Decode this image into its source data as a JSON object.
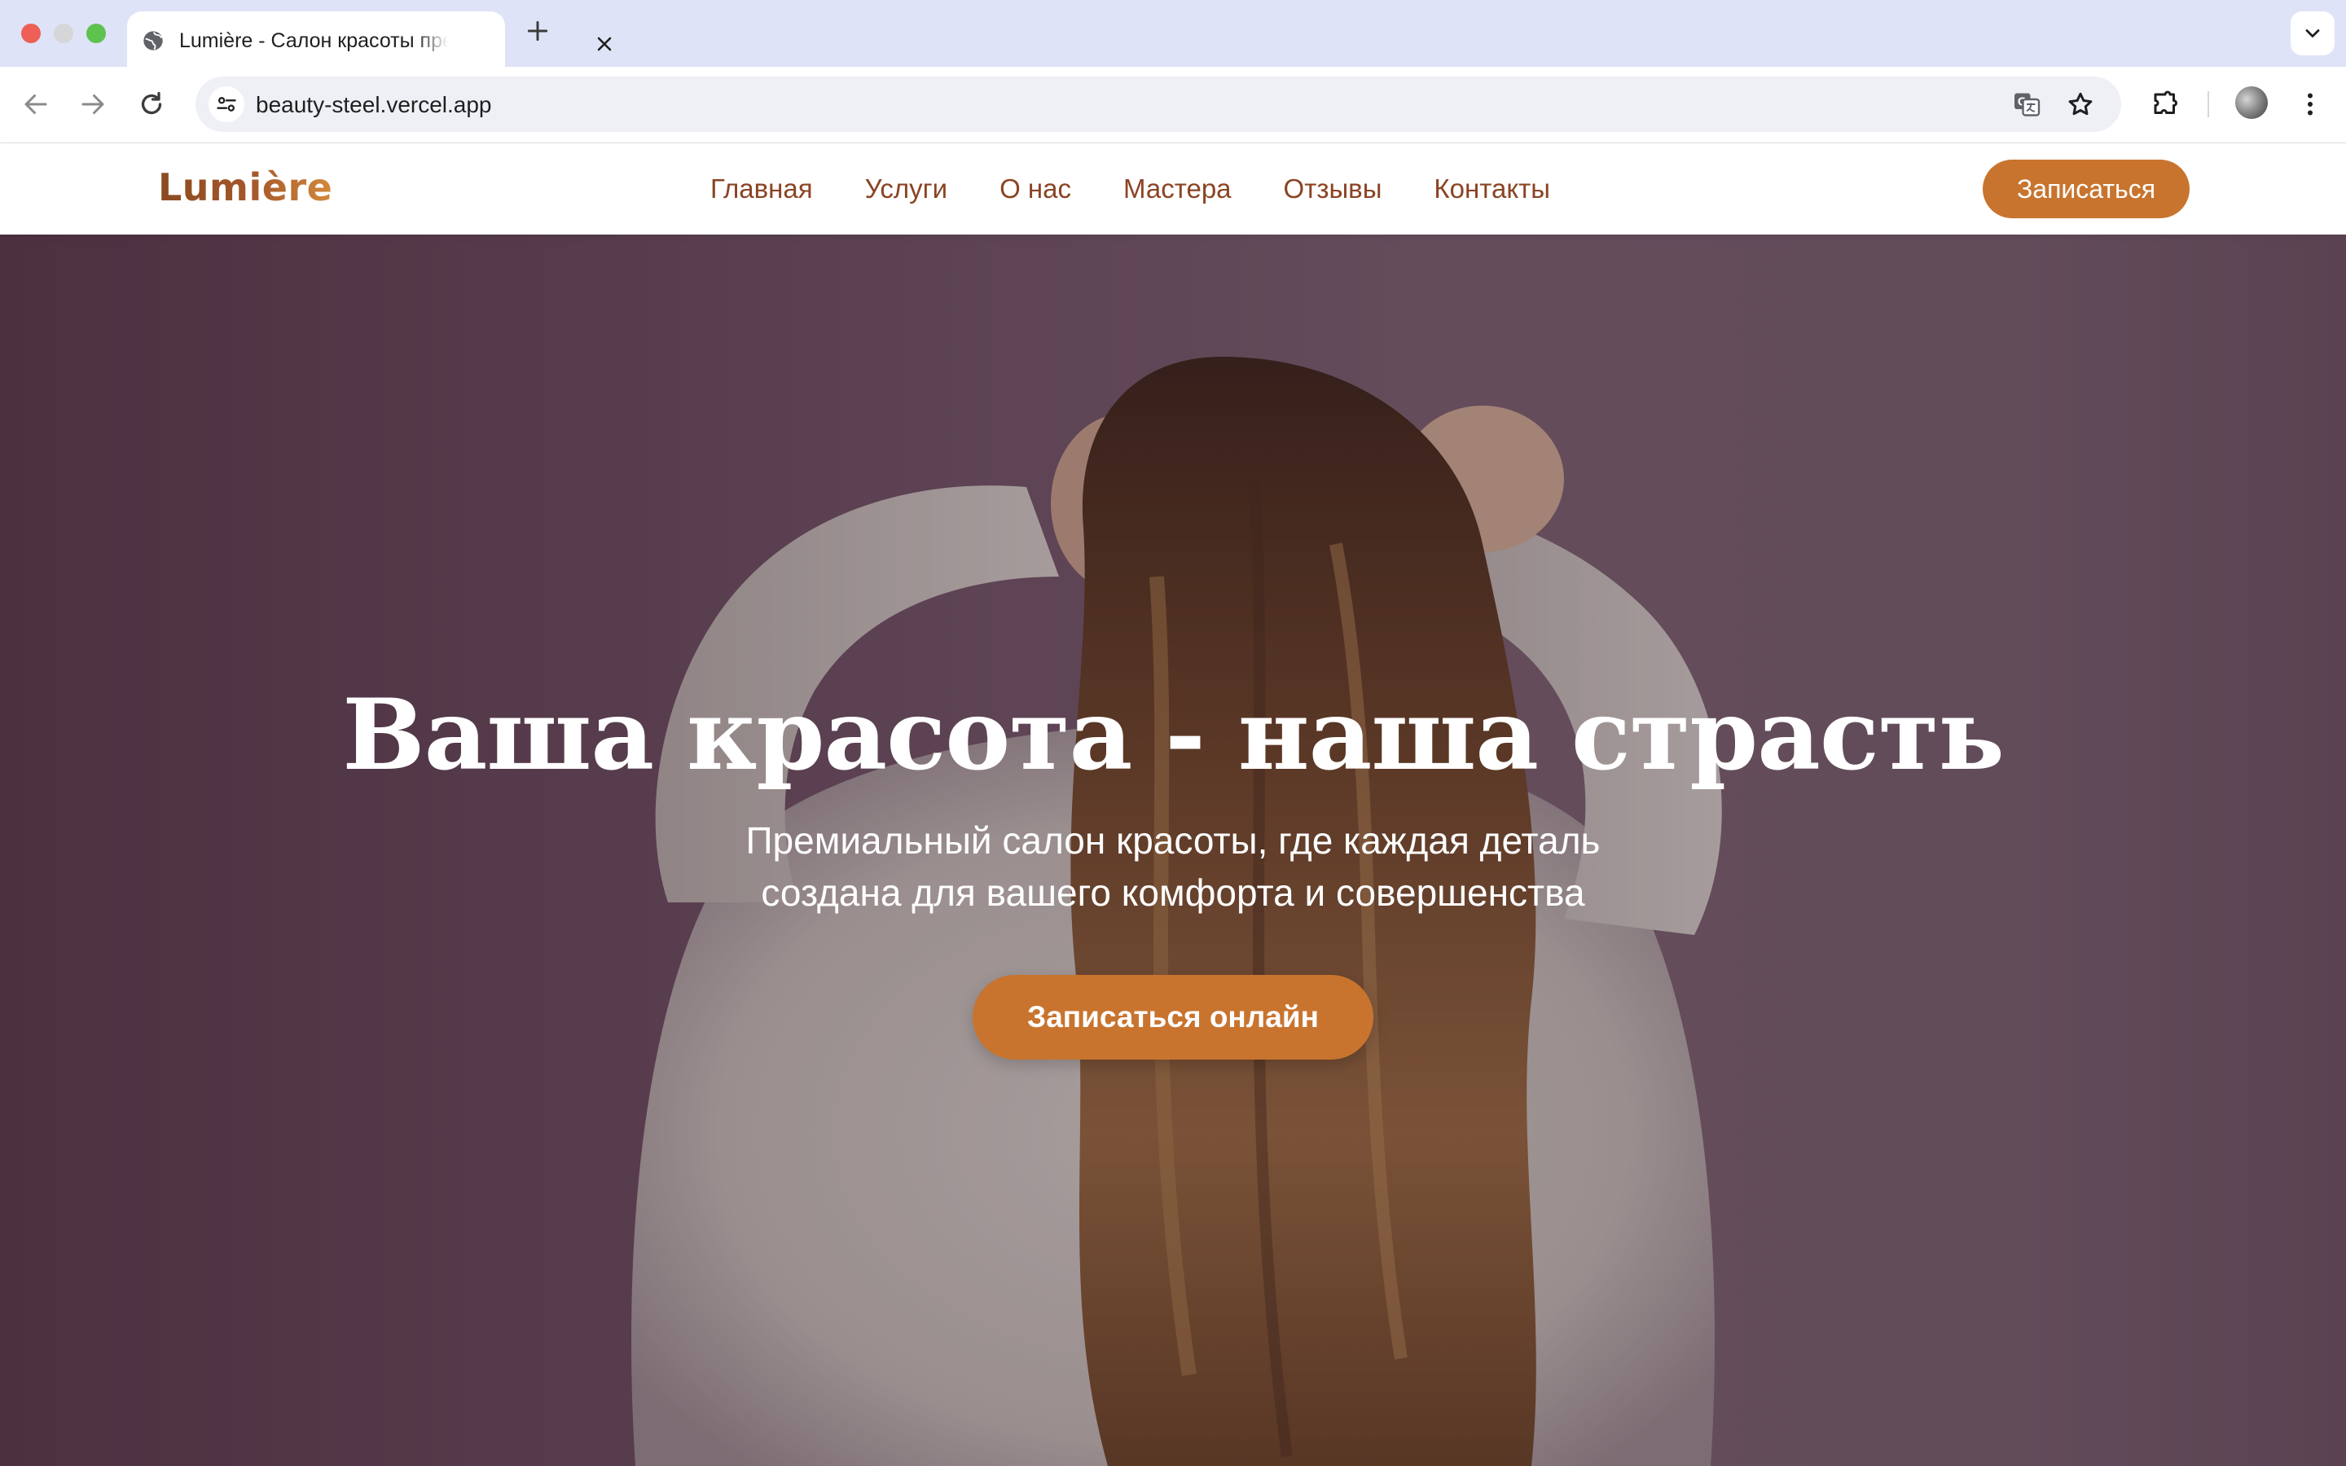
{
  "browser": {
    "tab_title": "Lumière - Салон красоты премиум класса",
    "url": "beauty-steel.vercel.app"
  },
  "site": {
    "logo": "Lumière",
    "nav": [
      "Главная",
      "Услуги",
      "О нас",
      "Мастера",
      "Отзывы",
      "Контакты"
    ],
    "header_cta": "Записаться"
  },
  "hero": {
    "title": "Ваша красота - наша страсть",
    "subtitle_line1": "Премиальный салон красоты, где каждая деталь",
    "subtitle_line2": "создана для вашего комфорта и совершенства",
    "cta": "Записаться онлайн"
  },
  "colors": {
    "accent": "#c8742f",
    "nav_text": "#8a4424",
    "tabstrip": "#dfe3f7"
  },
  "icons": [
    "globe-icon",
    "close-icon",
    "plus-icon",
    "chevron-down-icon",
    "back-icon",
    "forward-icon",
    "reload-icon",
    "site-info-icon",
    "translate-icon",
    "star-icon",
    "extensions-icon",
    "more-vert-icon"
  ]
}
